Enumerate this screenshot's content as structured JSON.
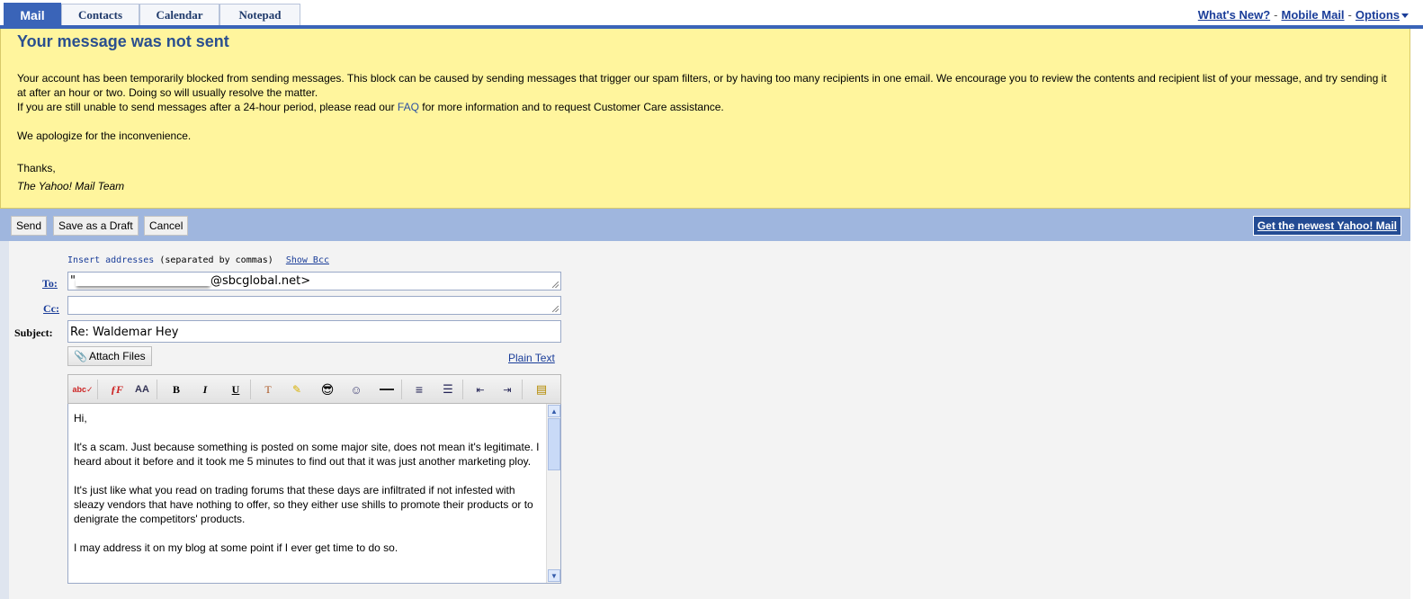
{
  "tabs": [
    {
      "label": "Mail",
      "active": true
    },
    {
      "label": "Contacts",
      "active": false
    },
    {
      "label": "Calendar",
      "active": false
    },
    {
      "label": "Notepad",
      "active": false
    }
  ],
  "top_links": {
    "whats_new": "What's New?",
    "mobile_mail": "Mobile Mail",
    "options": "Options",
    "separator": "-"
  },
  "warning": {
    "title": "Your message was not sent",
    "para1": "Your account has been temporarily blocked from sending messages. This block can be caused by sending messages that trigger our spam filters, or by having too many recipients in one email. We encourage you to review the contents and recipient list of your message, and try sending it at after an hour or two. Doing so will usually resolve the matter.",
    "para2_before": "If you are still unable to send messages after a 24-hour period, please read our ",
    "faq_link": "FAQ",
    "para2_after": " for more information and to request Customer Care assistance.",
    "apology": "We apologize for the inconvenience.",
    "thanks": "Thanks,",
    "signature": "The Yahoo! Mail Team"
  },
  "actions": {
    "send": "Send",
    "save_draft": "Save as a Draft",
    "cancel": "Cancel",
    "promo": "Get the newest Yahoo! Mail"
  },
  "compose": {
    "insert_addresses": "Insert addresses",
    "separated_note": "(separated by commas)",
    "show_bcc": "Show Bcc",
    "to_label": "To:",
    "to_value_prefix": "\"",
    "to_value_suffix": "@sbcglobal.net>",
    "cc_label": "Cc:",
    "cc_value": "",
    "subject_label": "Subject:",
    "subject_value": "Re: Waldemar Hey",
    "attach_files": "Attach Files",
    "plain_text": "Plain Text"
  },
  "toolbar_icons": [
    "spellcheck-icon",
    "font-family-icon",
    "font-size-icon",
    "bold-icon",
    "italic-icon",
    "underline-icon",
    "text-color-icon",
    "highlight-icon",
    "emoticon-icon",
    "stationery-icon",
    "horizontal-rule-icon",
    "align-icon",
    "list-icon",
    "outdent-icon",
    "indent-icon",
    "insert-image-icon"
  ],
  "body_paragraphs": [
    "Hi,",
    "It's a scam. Just because something is posted on some major site, does not mean it's legitimate. I heard about it before and it took me 5 minutes to find out that it was just another marketing ploy.",
    "It's just like what you read on trading forums that these days are infiltrated if not infested with sleazy vendors that have nothing to offer, so they either use shills to promote their products or to denigrate the competitors' products.",
    "I may address it on my blog at some point if I ever get time to do so."
  ]
}
